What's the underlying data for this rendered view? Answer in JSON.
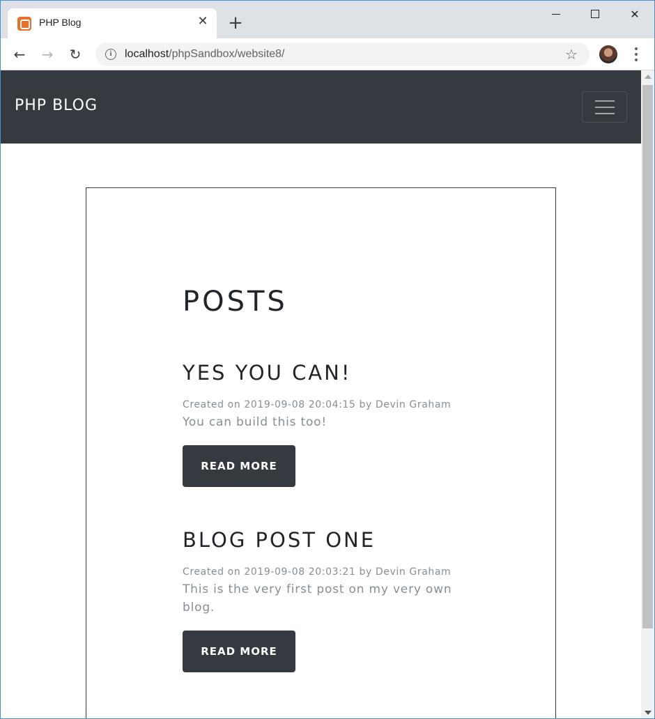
{
  "browser": {
    "tab_title": "PHP Blog",
    "tab_close_glyph": "✕",
    "new_tab_glyph": "+",
    "url_host": "localhost",
    "url_path": "/phpSandbox/website8/",
    "info_glyph": "i",
    "star_glyph": "☆",
    "back_glyph": "←",
    "forward_glyph": "→",
    "reload_glyph": "↻",
    "close_glyph": "✕"
  },
  "navbar": {
    "brand": "PHP BLOG"
  },
  "main": {
    "heading": "POSTS",
    "posts": [
      {
        "title": "YES YOU CAN!",
        "meta": "Created on 2019-09-08 20:04:15 by Devin Graham",
        "body": "You can build this too!",
        "button": "READ MORE"
      },
      {
        "title": "BLOG POST ONE",
        "meta": "Created on 2019-09-08 20:03:21 by Devin Graham",
        "body": "This is the very first post on my very own blog.",
        "button": "READ MORE"
      }
    ]
  },
  "colors": {
    "navbar_bg": "#343a40",
    "muted_text": "#868e96",
    "tab_favicon": "#e8702a"
  }
}
